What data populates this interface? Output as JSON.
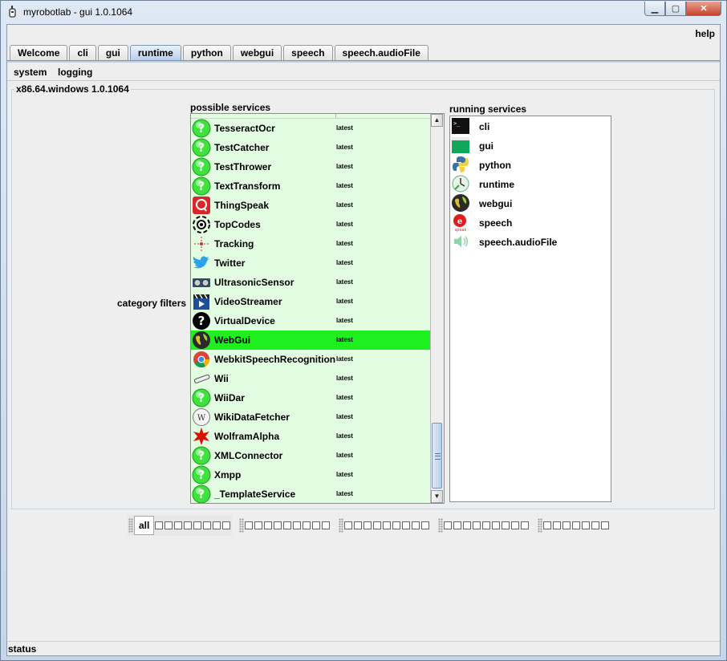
{
  "window": {
    "title": "myrobotlab - gui 1.0.1064"
  },
  "menu": {
    "help": "help"
  },
  "tabs": [
    "Welcome",
    "cli",
    "gui",
    "runtime",
    "python",
    "webgui",
    "speech",
    "speech.audioFile"
  ],
  "selected_tab": "runtime",
  "subtabs": [
    "system",
    "logging"
  ],
  "group_title": "x86.64.windows 1.0.1064",
  "possible": {
    "label": "possible services",
    "items": [
      {
        "name": "TesseractOcr",
        "version": "latest",
        "icon": "question-icon"
      },
      {
        "name": "TestCatcher",
        "version": "latest",
        "icon": "question-icon"
      },
      {
        "name": "TestThrower",
        "version": "latest",
        "icon": "question-icon"
      },
      {
        "name": "TextTransform",
        "version": "latest",
        "icon": "question-icon"
      },
      {
        "name": "ThingSpeak",
        "version": "latest",
        "icon": "thingspeak-icon"
      },
      {
        "name": "TopCodes",
        "version": "latest",
        "icon": "topcodes-icon"
      },
      {
        "name": "Tracking",
        "version": "latest",
        "icon": "tracking-icon"
      },
      {
        "name": "Twitter",
        "version": "latest",
        "icon": "twitter-bird-icon"
      },
      {
        "name": "UltrasonicSensor",
        "version": "latest",
        "icon": "ultrasonic-sensor-icon"
      },
      {
        "name": "VideoStreamer",
        "version": "latest",
        "icon": "film-clapper-icon"
      },
      {
        "name": "VirtualDevice",
        "version": "latest",
        "icon": "black-question-icon"
      },
      {
        "name": "WebGui",
        "version": "latest",
        "icon": "globe-icon",
        "selected": true
      },
      {
        "name": "WebkitSpeechRecognition",
        "version": "latest",
        "icon": "chrome-icon"
      },
      {
        "name": "Wii",
        "version": "latest",
        "icon": "wii-remote-icon"
      },
      {
        "name": "WiiDar",
        "version": "latest",
        "icon": "question-icon"
      },
      {
        "name": "WikiDataFetcher",
        "version": "latest",
        "icon": "wikipedia-globe-icon"
      },
      {
        "name": "WolframAlpha",
        "version": "latest",
        "icon": "wolfram-star-icon"
      },
      {
        "name": "XMLConnector",
        "version": "latest",
        "icon": "question-icon"
      },
      {
        "name": "Xmpp",
        "version": "latest",
        "icon": "question-icon"
      },
      {
        "name": "_TemplateService",
        "version": "latest",
        "icon": "question-icon"
      }
    ]
  },
  "running": {
    "label": "running services",
    "items": [
      {
        "name": "cli",
        "icon": "terminal-icon"
      },
      {
        "name": "gui",
        "icon": "gui-window-icon"
      },
      {
        "name": "python",
        "icon": "python-logo-icon"
      },
      {
        "name": "runtime",
        "icon": "runtime-icon"
      },
      {
        "name": "webgui",
        "icon": "globe-icon"
      },
      {
        "name": "speech",
        "icon": "speech-icon"
      },
      {
        "name": "speech.audioFile",
        "icon": "audio-speaker-icon"
      }
    ]
  },
  "category_filters": {
    "label": "category filters",
    "all_label": "all"
  },
  "status": "status",
  "colors": {
    "possible_bg": "#e2fde2",
    "selected_row": "#1fee1f",
    "tab_selected": "#b8cfe9"
  }
}
